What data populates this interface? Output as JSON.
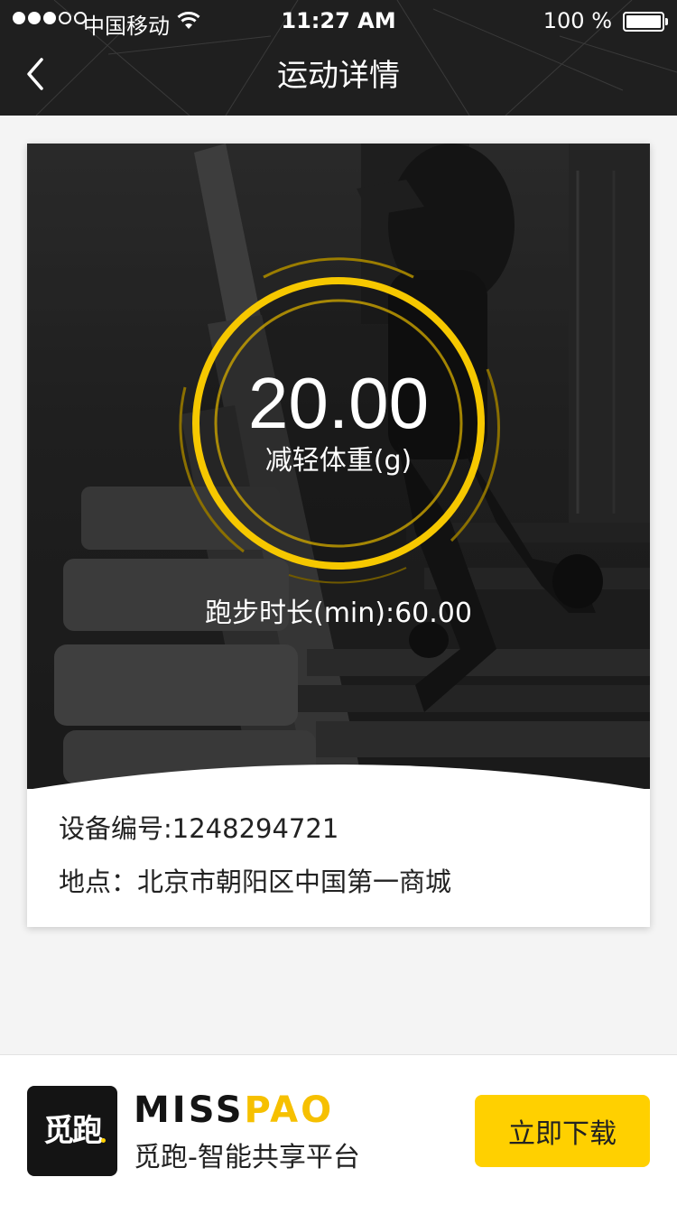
{
  "status_bar": {
    "carrier": "中国移动",
    "time": "11:27 AM",
    "battery": "100 %"
  },
  "nav": {
    "title": "运动详情"
  },
  "workout": {
    "value": "20.00",
    "value_label": "减轻体重(g)",
    "duration": "跑步时长(min):60.00"
  },
  "details": {
    "device": "设备编号:1248294721",
    "location": "地点：北京市朝阳区中国第一商城"
  },
  "banner": {
    "logo_text": "觅跑",
    "brand_part1": "MISS",
    "brand_part2": "PAO",
    "description": "觅跑-智能共享平台",
    "download_label": "立即下载"
  },
  "colors": {
    "header_bg": "#1f1f1f",
    "accent_yellow": "#ffd000",
    "page_bg": "#f4f4f4"
  }
}
